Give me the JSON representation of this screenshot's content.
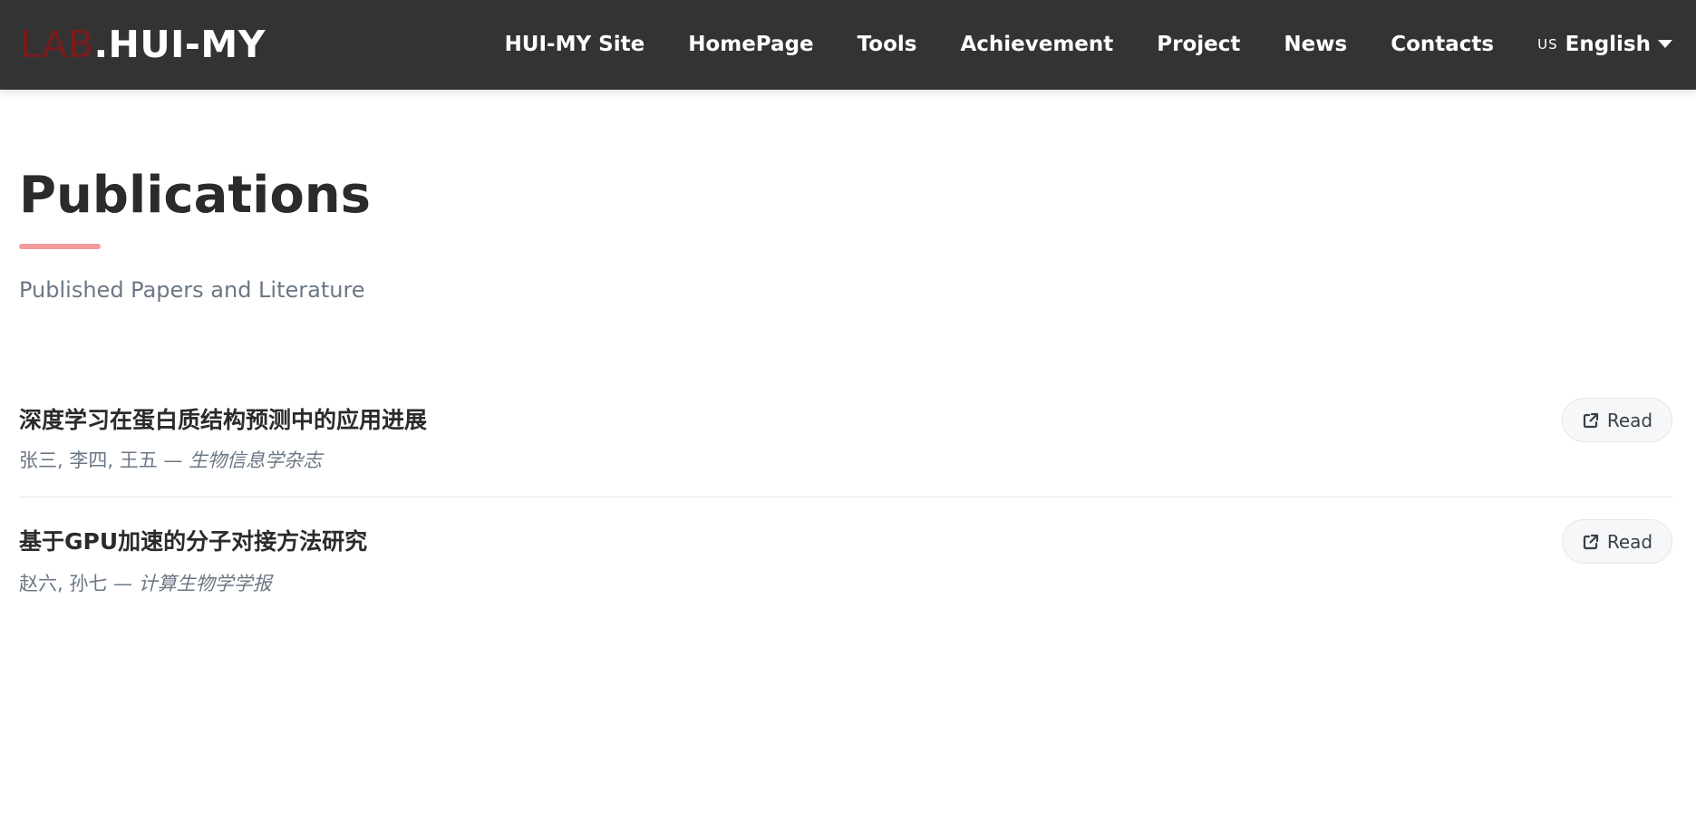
{
  "brand": {
    "prefix": "LAB",
    "main": ".HUI-MY"
  },
  "nav": {
    "items": [
      {
        "label": "HUI-MY Site"
      },
      {
        "label": "HomePage"
      },
      {
        "label": "Tools"
      },
      {
        "label": "Achievement"
      },
      {
        "label": "Project"
      },
      {
        "label": "News"
      },
      {
        "label": "Contacts"
      }
    ],
    "language": {
      "flag": "US",
      "label": "English",
      "icon": "chevron-down-icon"
    }
  },
  "page": {
    "title": "Publications",
    "subtitle": "Published Papers and Literature",
    "accent_color": "#f49a9a"
  },
  "publications": [
    {
      "title": "深度学习在蛋白质结构预测中的应用进展",
      "authors": "张三, 李四, 王五 —",
      "journal": "生物信息学杂志",
      "button_label": "Read",
      "button_icon": "external-link-icon"
    },
    {
      "title": "基于GPU加速的分子对接方法研究",
      "authors": "赵六, 孙七 —",
      "journal": "计算生物学学报",
      "button_label": "Read",
      "button_icon": "external-link-icon"
    }
  ]
}
